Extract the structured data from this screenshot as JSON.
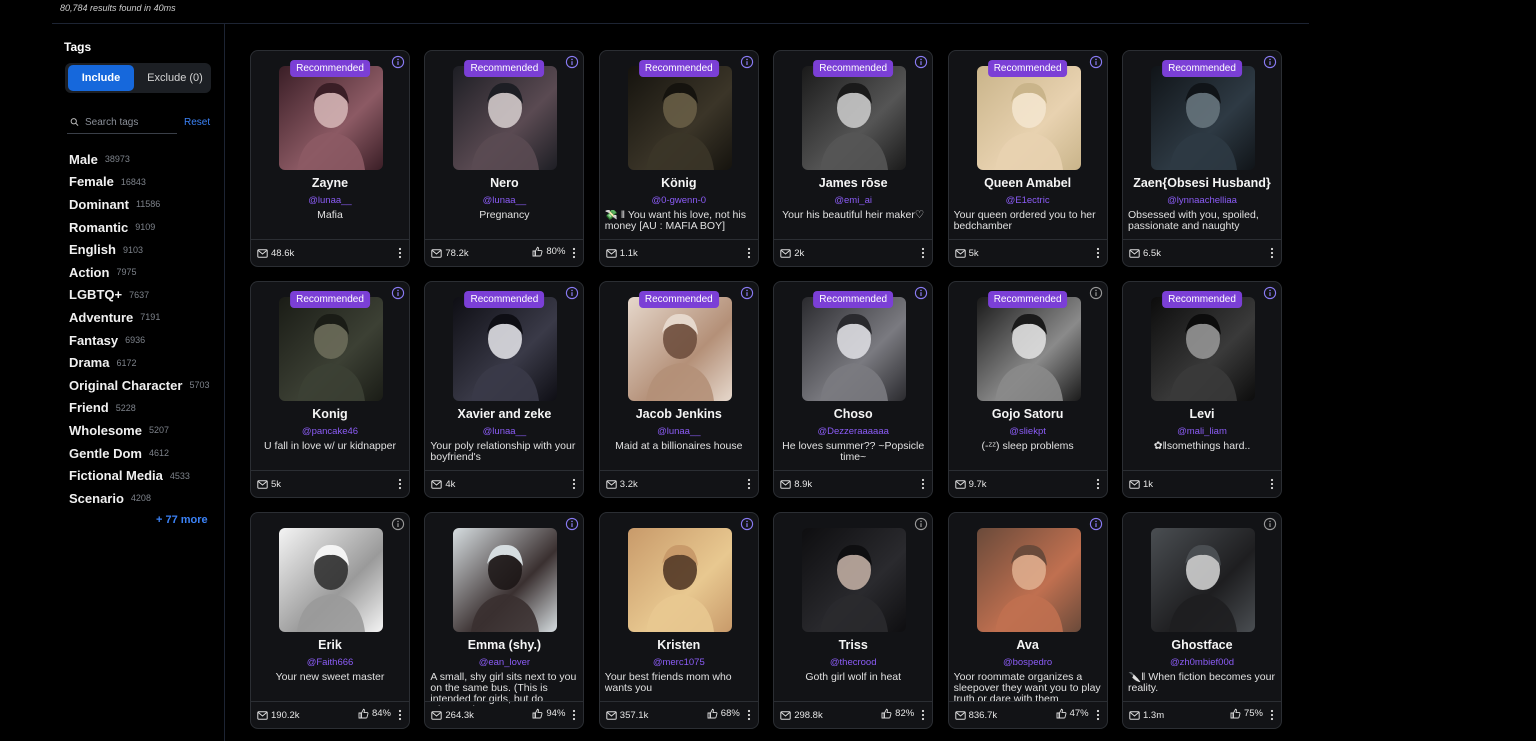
{
  "results_text": "80,784 results found in 40ms",
  "sidebar": {
    "title": "Tags",
    "include_label": "Include",
    "exclude_label": "Exclude (0)",
    "search_placeholder": "Search tags",
    "reset_label": "Reset",
    "more_label": "+ 77 more",
    "tags": [
      {
        "name": "Male",
        "count": "38973"
      },
      {
        "name": "Female",
        "count": "16843"
      },
      {
        "name": "Dominant",
        "count": "11586"
      },
      {
        "name": "Romantic",
        "count": "9109"
      },
      {
        "name": "English",
        "count": "9103"
      },
      {
        "name": "Action",
        "count": "7975"
      },
      {
        "name": "LGBTQ+",
        "count": "7637"
      },
      {
        "name": "Adventure",
        "count": "7191"
      },
      {
        "name": "Fantasy",
        "count": "6936"
      },
      {
        "name": "Drama",
        "count": "6172"
      },
      {
        "name": "Original Character",
        "count": "5703"
      },
      {
        "name": "Friend",
        "count": "5228"
      },
      {
        "name": "Wholesome",
        "count": "5207"
      },
      {
        "name": "Gentle Dom",
        "count": "4612"
      },
      {
        "name": "Fictional Media",
        "count": "4533"
      },
      {
        "name": "Scenario",
        "count": "4208"
      }
    ]
  },
  "colors": {
    "accent": "#1668dc",
    "badge": "#7b3fd6",
    "author": "#8b5cf6",
    "link": "#3b82f6"
  },
  "cards": [
    {
      "name": "Zayne",
      "author": "@lunaa__",
      "desc": "Mafia",
      "messages": "48.6k",
      "rating": "",
      "recommended": true,
      "info_color": "purple",
      "palette": [
        "#3a1e26",
        "#8c5a64",
        "#d7b8b8"
      ]
    },
    {
      "name": "Nero",
      "author": "@lunaa__",
      "desc": "Pregnancy",
      "messages": "78.2k",
      "rating": "80%",
      "recommended": true,
      "info_color": "purple",
      "palette": [
        "#1d1e24",
        "#5a4a52",
        "#d8d0d0"
      ]
    },
    {
      "name": "König",
      "author": "@0-gwenn-0",
      "desc": "💸 ‖ You want his love, not his money [AU : MAFIA BOY]",
      "messages": "1.1k",
      "rating": "",
      "recommended": true,
      "info_color": "purple",
      "palette": [
        "#15130e",
        "#3b3528",
        "#6b6048"
      ]
    },
    {
      "name": "James rōse",
      "author": "@emi_ai",
      "desc": "Your his beautiful heir maker♡",
      "messages": "2k",
      "rating": "",
      "recommended": true,
      "info_color": "purple",
      "palette": [
        "#1a1a1a",
        "#555555",
        "#cfcfcf"
      ]
    },
    {
      "name": "Queen Amabel",
      "author": "@E1ectric",
      "desc": "Your queen ordered you to her bedchamber",
      "messages": "5k",
      "rating": "",
      "recommended": true,
      "info_color": "purple",
      "palette": [
        "#c9b48a",
        "#e8d2b0",
        "#f4e6d0"
      ]
    },
    {
      "name": "Zaen{Obsesi Husband}",
      "author": "@lynnaachelliaa",
      "desc": "Obsessed with you, spoiled, passionate and naughty",
      "messages": "6.5k",
      "rating": "",
      "recommended": true,
      "info_color": "purple",
      "palette": [
        "#101418",
        "#2e3a44",
        "#6a7880"
      ]
    },
    {
      "name": "Konig",
      "author": "@pancake46",
      "desc": "U fall in love w/ ur kidnapper",
      "messages": "5k",
      "rating": "",
      "recommended": true,
      "info_color": "purple",
      "palette": [
        "#1a1c16",
        "#3c4034",
        "#6e6e5c"
      ]
    },
    {
      "name": "Xavier and zeke",
      "author": "@lunaa__",
      "desc": "Your poly relationship with your boyfriend's",
      "messages": "4k",
      "rating": "",
      "recommended": true,
      "info_color": "purple",
      "palette": [
        "#0e0e14",
        "#3a3a48",
        "#e8e8ec"
      ]
    },
    {
      "name": "Jacob Jenkins",
      "author": "@lunaa__",
      "desc": "Maid at a billionaires house",
      "messages": "3.2k",
      "rating": "",
      "recommended": true,
      "info_color": "purple",
      "palette": [
        "#e6d8cc",
        "#b49078",
        "#6a4a3a"
      ]
    },
    {
      "name": "Choso",
      "author": "@Dezzeraaaaaa",
      "desc": "He loves summer?? ~Popsicle time~",
      "messages": "8.9k",
      "rating": "",
      "recommended": true,
      "info_color": "purple",
      "palette": [
        "#2a2a2e",
        "#7a7a80",
        "#e2e2e6"
      ]
    },
    {
      "name": "Gojo Satoru",
      "author": "@sliekpt",
      "desc": "(-ᶻᶻ) sleep problems",
      "messages": "9.7k",
      "rating": "",
      "recommended": true,
      "info_color": "gray",
      "palette": [
        "#1a1a1a",
        "#8a8a8a",
        "#e4e4e4"
      ]
    },
    {
      "name": "Levi",
      "author": "@mali_liam",
      "desc": "✿‖somethings hard..",
      "messages": "1k",
      "rating": "",
      "recommended": true,
      "info_color": "purple",
      "palette": [
        "#0c0c0c",
        "#3a3a3a",
        "#9a9a9a"
      ]
    },
    {
      "name": "Erik",
      "author": "@Faith666",
      "desc": "Your new sweet master",
      "messages": "190.2k",
      "rating": "84%",
      "recommended": false,
      "info_color": "gray",
      "palette": [
        "#f4f4f4",
        "#9a9a9a",
        "#2a2a2a"
      ]
    },
    {
      "name": "Emma (shy.)",
      "author": "@ean_lover",
      "desc": "A small, shy girl sits next to you on the same bus. (This is intended for girls, but do whatever)",
      "messages": "264.3k",
      "rating": "94%",
      "recommended": false,
      "info_color": "purple",
      "palette": [
        "#d6dde0",
        "#3a3030",
        "#1a1414"
      ]
    },
    {
      "name": "Kristen",
      "author": "@merc1075",
      "desc": "Your best friends mom who wants you",
      "messages": "357.1k",
      "rating": "68%",
      "recommended": false,
      "info_color": "purple",
      "palette": [
        "#c89a6a",
        "#e8c890",
        "#4a3020"
      ]
    },
    {
      "name": "Triss",
      "author": "@thecrood",
      "desc": "Goth girl wolf in heat",
      "messages": "298.8k",
      "rating": "82%",
      "recommended": false,
      "info_color": "gray",
      "palette": [
        "#0e0e10",
        "#2a2a2e",
        "#c8b4a8"
      ]
    },
    {
      "name": "Ava",
      "author": "@bospedro",
      "desc": "Yoor roommate organizes a sleepover they want you to play truth or dare with them",
      "messages": "836.7k",
      "rating": "47%",
      "recommended": false,
      "info_color": "purple",
      "palette": [
        "#6a4a3a",
        "#c07050",
        "#e0b090"
      ]
    },
    {
      "name": "Ghostface",
      "author": "@zh0mbief00d",
      "desc": "🔪‖ When fiction becomes your reality.",
      "messages": "1.3m",
      "rating": "75%",
      "recommended": false,
      "info_color": "gray",
      "palette": [
        "#4a4e52",
        "#1e1e20",
        "#d8d8d8"
      ]
    }
  ]
}
